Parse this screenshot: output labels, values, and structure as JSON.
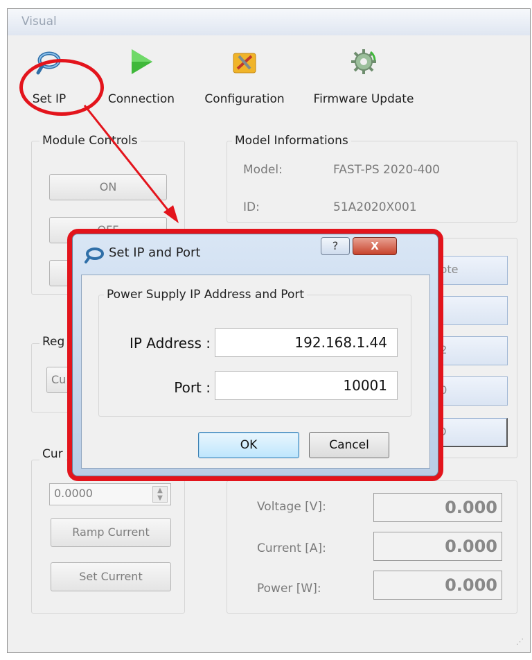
{
  "window": {
    "title": "Visual"
  },
  "toolbar": {
    "set_ip": "Set IP",
    "connection": "Connection",
    "configuration": "Configuration",
    "firmware_update": "Firmware Update"
  },
  "module_controls": {
    "title": "Module Controls",
    "on_label": "ON",
    "off_label": "OFF"
  },
  "model_info": {
    "title": "Model Informations",
    "model_label": "Model:",
    "model_value": "FAST-PS 2020-400",
    "id_label": "ID:",
    "id_value": "51A2020X001"
  },
  "partial_labels": {
    "regulation": "Reg",
    "regulation_value": "Cu",
    "current": "Cur",
    "remote": "mote",
    "off": "FF",
    "val1": "3.2",
    "val2": ".00",
    "no": "NO"
  },
  "current_controls": {
    "spin_value": "0.0000",
    "ramp_label": "Ramp Current",
    "set_label": "Set Current"
  },
  "readouts": {
    "voltage_label": "Voltage [V]:",
    "voltage_value": "0.000",
    "current_label": "Current [A]:",
    "current_value": "0.000",
    "power_label": "Power [W]:",
    "power_value": "0.000"
  },
  "dialog": {
    "title": "Set IP and Port",
    "help": "?",
    "close": "X",
    "group_title": "Power Supply IP Address and Port",
    "ip_label": "IP Address :",
    "ip_value": "192.168.1.44",
    "port_label": "Port :",
    "port_value": "10001",
    "ok_label": "OK",
    "cancel_label": "Cancel"
  },
  "colors": {
    "annotation": "#e3141c",
    "accent": "#3c7fb1"
  }
}
